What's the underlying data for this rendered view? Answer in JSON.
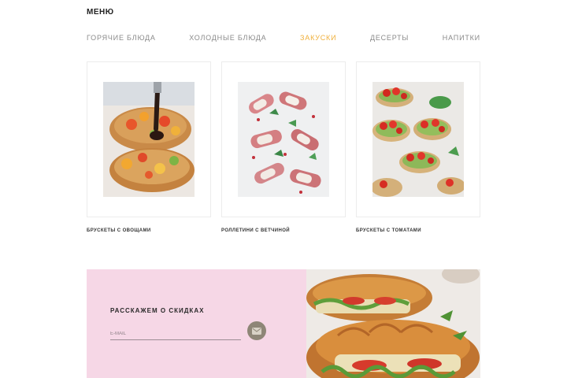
{
  "menu": {
    "title": "МЕНЮ"
  },
  "tabs": [
    {
      "label": "ГОРЯЧИЕ БЛЮДА",
      "active": false
    },
    {
      "label": "ХОЛОДНЫЕ БЛЮДА",
      "active": false
    },
    {
      "label": "ЗАКУСКИ",
      "active": true
    },
    {
      "label": "ДЕСЕРТЫ",
      "active": false
    },
    {
      "label": "НАПИТКИ",
      "active": false
    }
  ],
  "cards": [
    {
      "caption": "БРУСКЕТЫ С ОВОЩАМИ"
    },
    {
      "caption": "РОЛЛЕТИНИ С ВЕТЧИНОЙ"
    },
    {
      "caption": "БРУСКЕТЫ С ТОМАТАМИ"
    }
  ],
  "promo": {
    "heading": "РАССКАЖЕМ О СКИДКАХ",
    "email_placeholder": "E-MAIL"
  },
  "colors": {
    "active_tab": "#f0b03c",
    "promo_background": "#f6d7e6",
    "send_button": "#8e8677"
  },
  "icons": {
    "send": "envelope-icon"
  }
}
